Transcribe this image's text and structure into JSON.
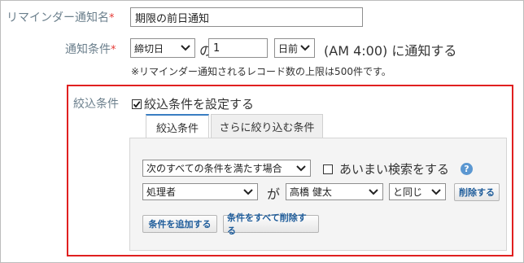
{
  "fields": {
    "name_label": "リマインダー通知名",
    "required_mark": "*",
    "name_value": "期限の前日通知",
    "condition_label": "通知条件",
    "date_field": "締切日",
    "connector_no": "の",
    "offset_value": "1",
    "direction": "日前",
    "time_text": "(AM 4:00) に通知する",
    "limit_note": "※リマインダー通知されるレコード数の上限は500件です。"
  },
  "filter": {
    "label": "絞込条件",
    "set_checkbox_label": "絞込条件を設定する",
    "set_checked": true,
    "tabs": [
      {
        "label": "絞込条件",
        "active": true
      },
      {
        "label": "さらに絞り込む条件",
        "active": false
      }
    ],
    "match_mode": "次のすべての条件を満たす場合",
    "fuzzy_label": "あいまい検索をする",
    "fuzzy_checked": false,
    "help": "?",
    "row": {
      "field": "処理者",
      "connector": "が",
      "value": "高橋 健太",
      "operator": "と同じ",
      "delete_label": "削除する"
    },
    "add_label": "条件を追加する",
    "delete_all_label": "条件をすべて削除する"
  },
  "colors": {
    "accent": "#3a7ec2",
    "required": "#e53935",
    "highlight_border": "#e02020",
    "label": "#6b7f8c"
  }
}
